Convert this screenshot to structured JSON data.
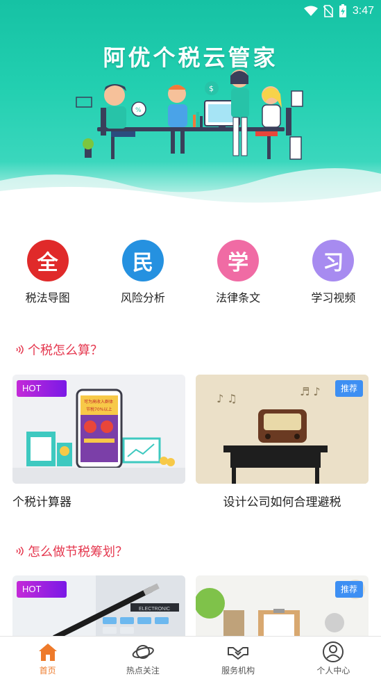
{
  "status_bar": {
    "time": "3:47"
  },
  "banner": {
    "title": "阿优个税云管家"
  },
  "categories": [
    {
      "glyph": "全",
      "label": "税法导图",
      "color": "#e02a2a"
    },
    {
      "glyph": "民",
      "label": "风险分析",
      "color": "#2591e0"
    },
    {
      "glyph": "学",
      "label": "法律条文",
      "color": "#f06ba4"
    },
    {
      "glyph": "习",
      "label": "学习视频",
      "color": "#a78bf0"
    }
  ],
  "sections": [
    {
      "title": "个税怎么算？",
      "cards": [
        {
          "badge": "HOT",
          "caption": "个税计算器"
        },
        {
          "badge": "推荐",
          "caption": "设计公司如何合理避税"
        }
      ]
    },
    {
      "title": "怎么做节税筹划？",
      "cards": [
        {
          "badge": "HOT",
          "caption": ""
        },
        {
          "badge": "推荐",
          "caption": ""
        }
      ]
    }
  ],
  "card_art_text": {
    "phone_line1": "可为高收入群体",
    "phone_line2": "节税70%以上",
    "calc_brand": "ELECTRONIC"
  },
  "bottom_nav": [
    {
      "label": "首页",
      "icon": "home-icon",
      "active": true
    },
    {
      "label": "热点关注",
      "icon": "planet-icon",
      "active": false
    },
    {
      "label": "服务机构",
      "icon": "handshake-icon",
      "active": false
    },
    {
      "label": "个人中心",
      "icon": "user-icon",
      "active": false
    }
  ],
  "colors": {
    "accent": "#e5384f",
    "nav_active": "#ee7a2a",
    "banner": "#22cfb0"
  }
}
